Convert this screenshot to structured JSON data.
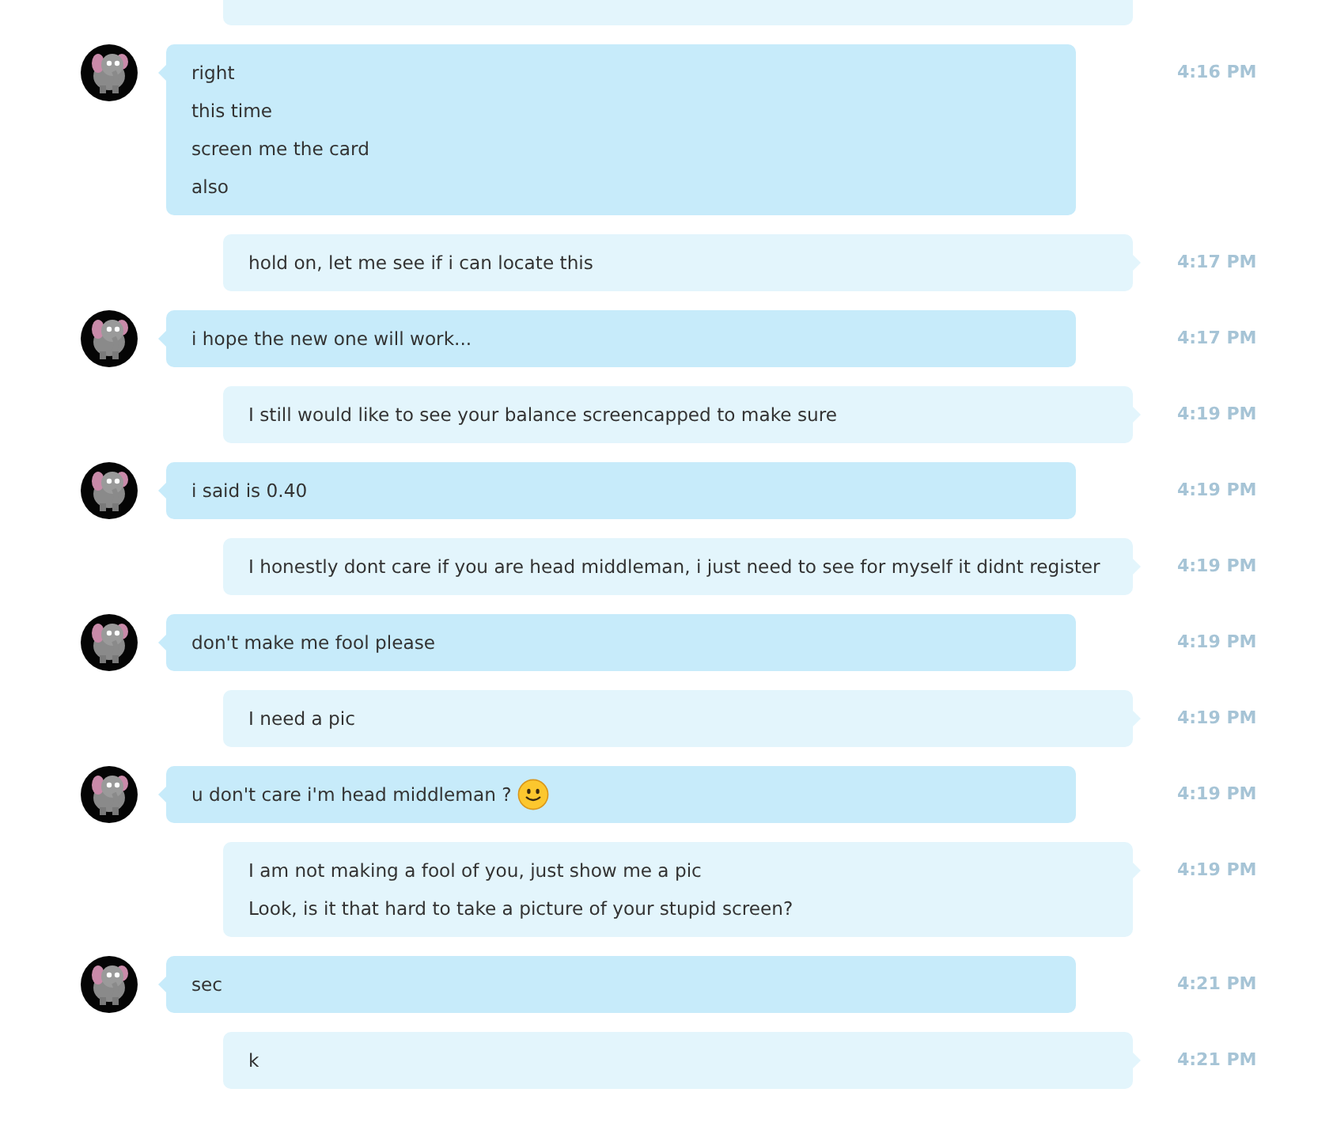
{
  "messages": [
    {
      "kind": "outgoing",
      "partial": true
    },
    {
      "kind": "incoming",
      "lines": [
        "right",
        "this time",
        "screen me the card",
        "also"
      ],
      "time": "4:16 PM"
    },
    {
      "kind": "outgoing",
      "lines": [
        "hold on, let me see if i can locate this"
      ],
      "time": "4:17 PM"
    },
    {
      "kind": "incoming",
      "lines": [
        "i hope the new one will work..."
      ],
      "time": "4:17 PM"
    },
    {
      "kind": "outgoing",
      "lines": [
        "I still would like to see your balance screencapped to make sure"
      ],
      "time": "4:19 PM"
    },
    {
      "kind": "incoming",
      "lines": [
        "i said is 0.40"
      ],
      "time": "4:19 PM"
    },
    {
      "kind": "outgoing",
      "lines": [
        "I honestly dont care if you are head middleman, i just need to see for myself it didnt register"
      ],
      "time": "4:19 PM"
    },
    {
      "kind": "incoming",
      "lines": [
        "don't make me fool please"
      ],
      "time": "4:19 PM"
    },
    {
      "kind": "outgoing",
      "lines": [
        "I need a pic"
      ],
      "time": "4:19 PM"
    },
    {
      "kind": "incoming",
      "lines": [
        "u don't care i'm head middleman ?"
      ],
      "emoticon": true,
      "time": "4:19 PM"
    },
    {
      "kind": "outgoing",
      "lines": [
        "I am not making a fool of you, just show me a pic",
        "Look, is it that hard to take a picture of your stupid screen?"
      ],
      "time": "4:19 PM"
    },
    {
      "kind": "incoming",
      "lines": [
        "sec"
      ],
      "time": "4:21 PM"
    },
    {
      "kind": "outgoing",
      "lines": [
        "k"
      ],
      "time": "4:21 PM"
    }
  ]
}
